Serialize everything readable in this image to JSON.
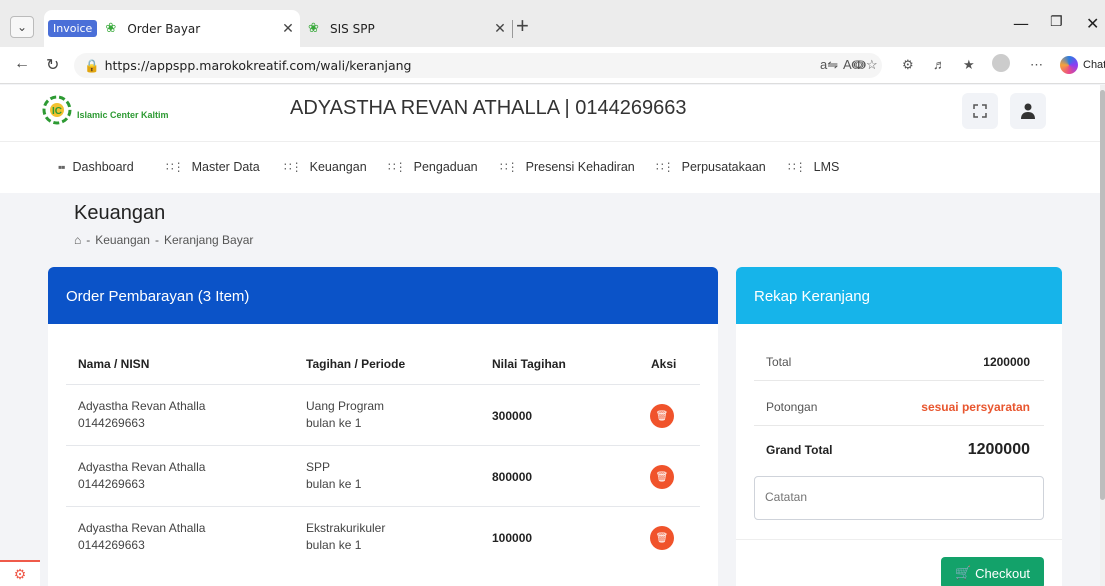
{
  "browser": {
    "tabs": [
      {
        "group": "Invoice",
        "title": "Order Bayar"
      },
      {
        "title": "SIS SPP"
      }
    ],
    "url": "https://appspp.marokokreatif.com/wali/keranjang",
    "chat_label": "Chat"
  },
  "header": {
    "logo_text": "Islamic Center Kaltim",
    "title": "ADYASTHA REVAN ATHALLA | 0144269663"
  },
  "menu": [
    {
      "label": "Dashboard"
    },
    {
      "label": "Master Data"
    },
    {
      "label": "Keuangan"
    },
    {
      "label": "Pengaduan"
    },
    {
      "label": "Presensi Kehadiran"
    },
    {
      "label": "Perpusatakaan"
    },
    {
      "label": "LMS"
    }
  ],
  "page": {
    "title": "Keuangan",
    "breadcrumb": [
      "Keuangan",
      "Keranjang Bayar"
    ]
  },
  "order": {
    "title": "Order Pembarayan (3 Item)",
    "columns": [
      "Nama / NISN",
      "Tagihan / Periode",
      "Nilai Tagihan",
      "Aksi"
    ],
    "rows": [
      {
        "name": "Adyastha Revan Athalla",
        "nisn": "0144269663",
        "tagihan": "Uang Program",
        "periode": "bulan ke 1",
        "nilai": "300000"
      },
      {
        "name": "Adyastha Revan Athalla",
        "nisn": "0144269663",
        "tagihan": "SPP",
        "periode": "bulan ke 1",
        "nilai": "800000"
      },
      {
        "name": "Adyastha Revan Athalla",
        "nisn": "0144269663",
        "tagihan": "Ekstrakurikuler",
        "periode": "bulan ke 1",
        "nilai": "100000"
      }
    ]
  },
  "rekap": {
    "title": "Rekap Keranjang",
    "total_label": "Total",
    "total_value": "1200000",
    "potongan_label": "Potongan",
    "potongan_value": "sesuai persyaratan",
    "grand_label": "Grand Total",
    "grand_value": "1200000",
    "catatan_placeholder": "Catatan",
    "checkout_label": "Checkout"
  },
  "colors": {
    "order_header": "#0b53c8",
    "rekap_header": "#16b4ea",
    "delete_button": "#f0532b",
    "checkout_button": "#13a26a",
    "potongan_text": "#e8562f"
  }
}
